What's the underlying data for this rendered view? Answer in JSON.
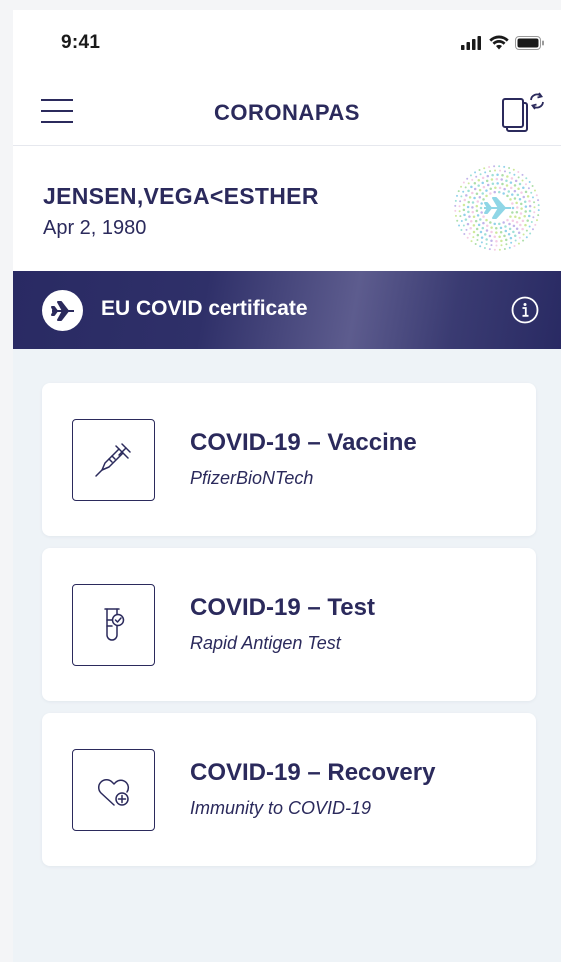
{
  "status_bar": {
    "time": "9:41",
    "icons": [
      "signal-icon",
      "wifi-icon",
      "battery-icon"
    ]
  },
  "nav": {
    "title": "CORONAPAS",
    "left_icon": "menu-icon",
    "right_icon": "switch-card-icon"
  },
  "holder": {
    "name": "JENSEN,VEGA<ESTHER",
    "dob": "Apr 2, 1980",
    "logo_icon": "travel-plane-logo-icon"
  },
  "banner": {
    "label": "EU COVID certificate",
    "left_icon": "plane-icon",
    "right_icon": "info-icon"
  },
  "certificates": [
    {
      "title": "COVID-19 – Vaccine",
      "subtitle": "PfizerBioNTech",
      "icon": "syringe-icon"
    },
    {
      "title": "COVID-19 – Test",
      "subtitle": "Rapid Antigen Test",
      "icon": "test-tube-icon"
    },
    {
      "title": "COVID-19 – Recovery",
      "subtitle": "Immunity to COVID-19",
      "icon": "heart-plus-icon"
    }
  ],
  "colors": {
    "primary": "#2b2a5c",
    "background": "#eef3f7",
    "banner": "#292a63",
    "card": "#ffffff"
  }
}
